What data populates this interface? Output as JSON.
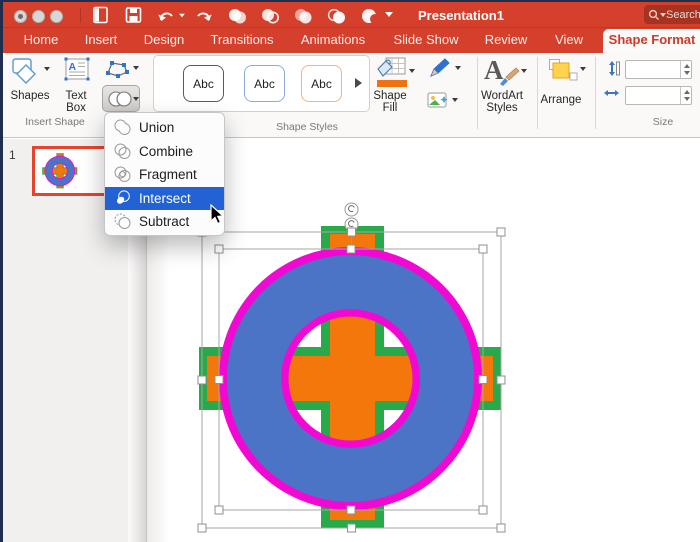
{
  "colors": {
    "brand_red": "#D5402C",
    "active_tab_text": "#CE3A28",
    "menu_highlight": "#2262D4",
    "shape_magenta": "#F109D3",
    "shape_blue": "#4B74C7",
    "shape_orange": "#F3770B",
    "shape_green": "#28A94A",
    "thumbnail_border": "#E8432D"
  },
  "titlebar": {
    "title": "Presentation1",
    "search_placeholder": "Search",
    "qat_icons": [
      "new-presentation-icon",
      "save-icon",
      "undo-icon",
      "redo-icon",
      "merge-union-icon",
      "merge-combine-icon",
      "merge-fragment-icon",
      "merge-intersect-icon",
      "merge-subtract-icon",
      "toolbar-overflow-icon"
    ]
  },
  "tabs": [
    {
      "label": "Home",
      "active": false
    },
    {
      "label": "Insert",
      "active": false
    },
    {
      "label": "Design",
      "active": false
    },
    {
      "label": "Transitions",
      "active": false
    },
    {
      "label": "Animations",
      "active": false
    },
    {
      "label": "Slide Show",
      "active": false
    },
    {
      "label": "Review",
      "active": false
    },
    {
      "label": "View",
      "active": false
    },
    {
      "label": "Shape Format",
      "active": true
    }
  ],
  "ribbon": {
    "insert_shapes": {
      "shapes_label": "Shapes",
      "text_box_label": "Text Box",
      "group_label": "Insert Shape"
    },
    "shape_styles": {
      "previews": [
        "Abc",
        "Abc",
        "Abc"
      ],
      "group_label": "Shape Styles"
    },
    "fill_group": {
      "shape_fill_label": "Shape Fill"
    },
    "wordart": {
      "label": "WordArt Styles"
    },
    "arrange": {
      "label": "Arrange"
    },
    "size": {
      "group_label": "Size",
      "height_value": "",
      "width_value": ""
    }
  },
  "merge_menu": {
    "items": [
      {
        "label": "Union",
        "selected": false
      },
      {
        "label": "Combine",
        "selected": false
      },
      {
        "label": "Fragment",
        "selected": false
      },
      {
        "label": "Intersect",
        "selected": true
      },
      {
        "label": "Subtract",
        "selected": false
      }
    ]
  },
  "slide_panel": {
    "slides": [
      {
        "number": "1"
      }
    ]
  }
}
